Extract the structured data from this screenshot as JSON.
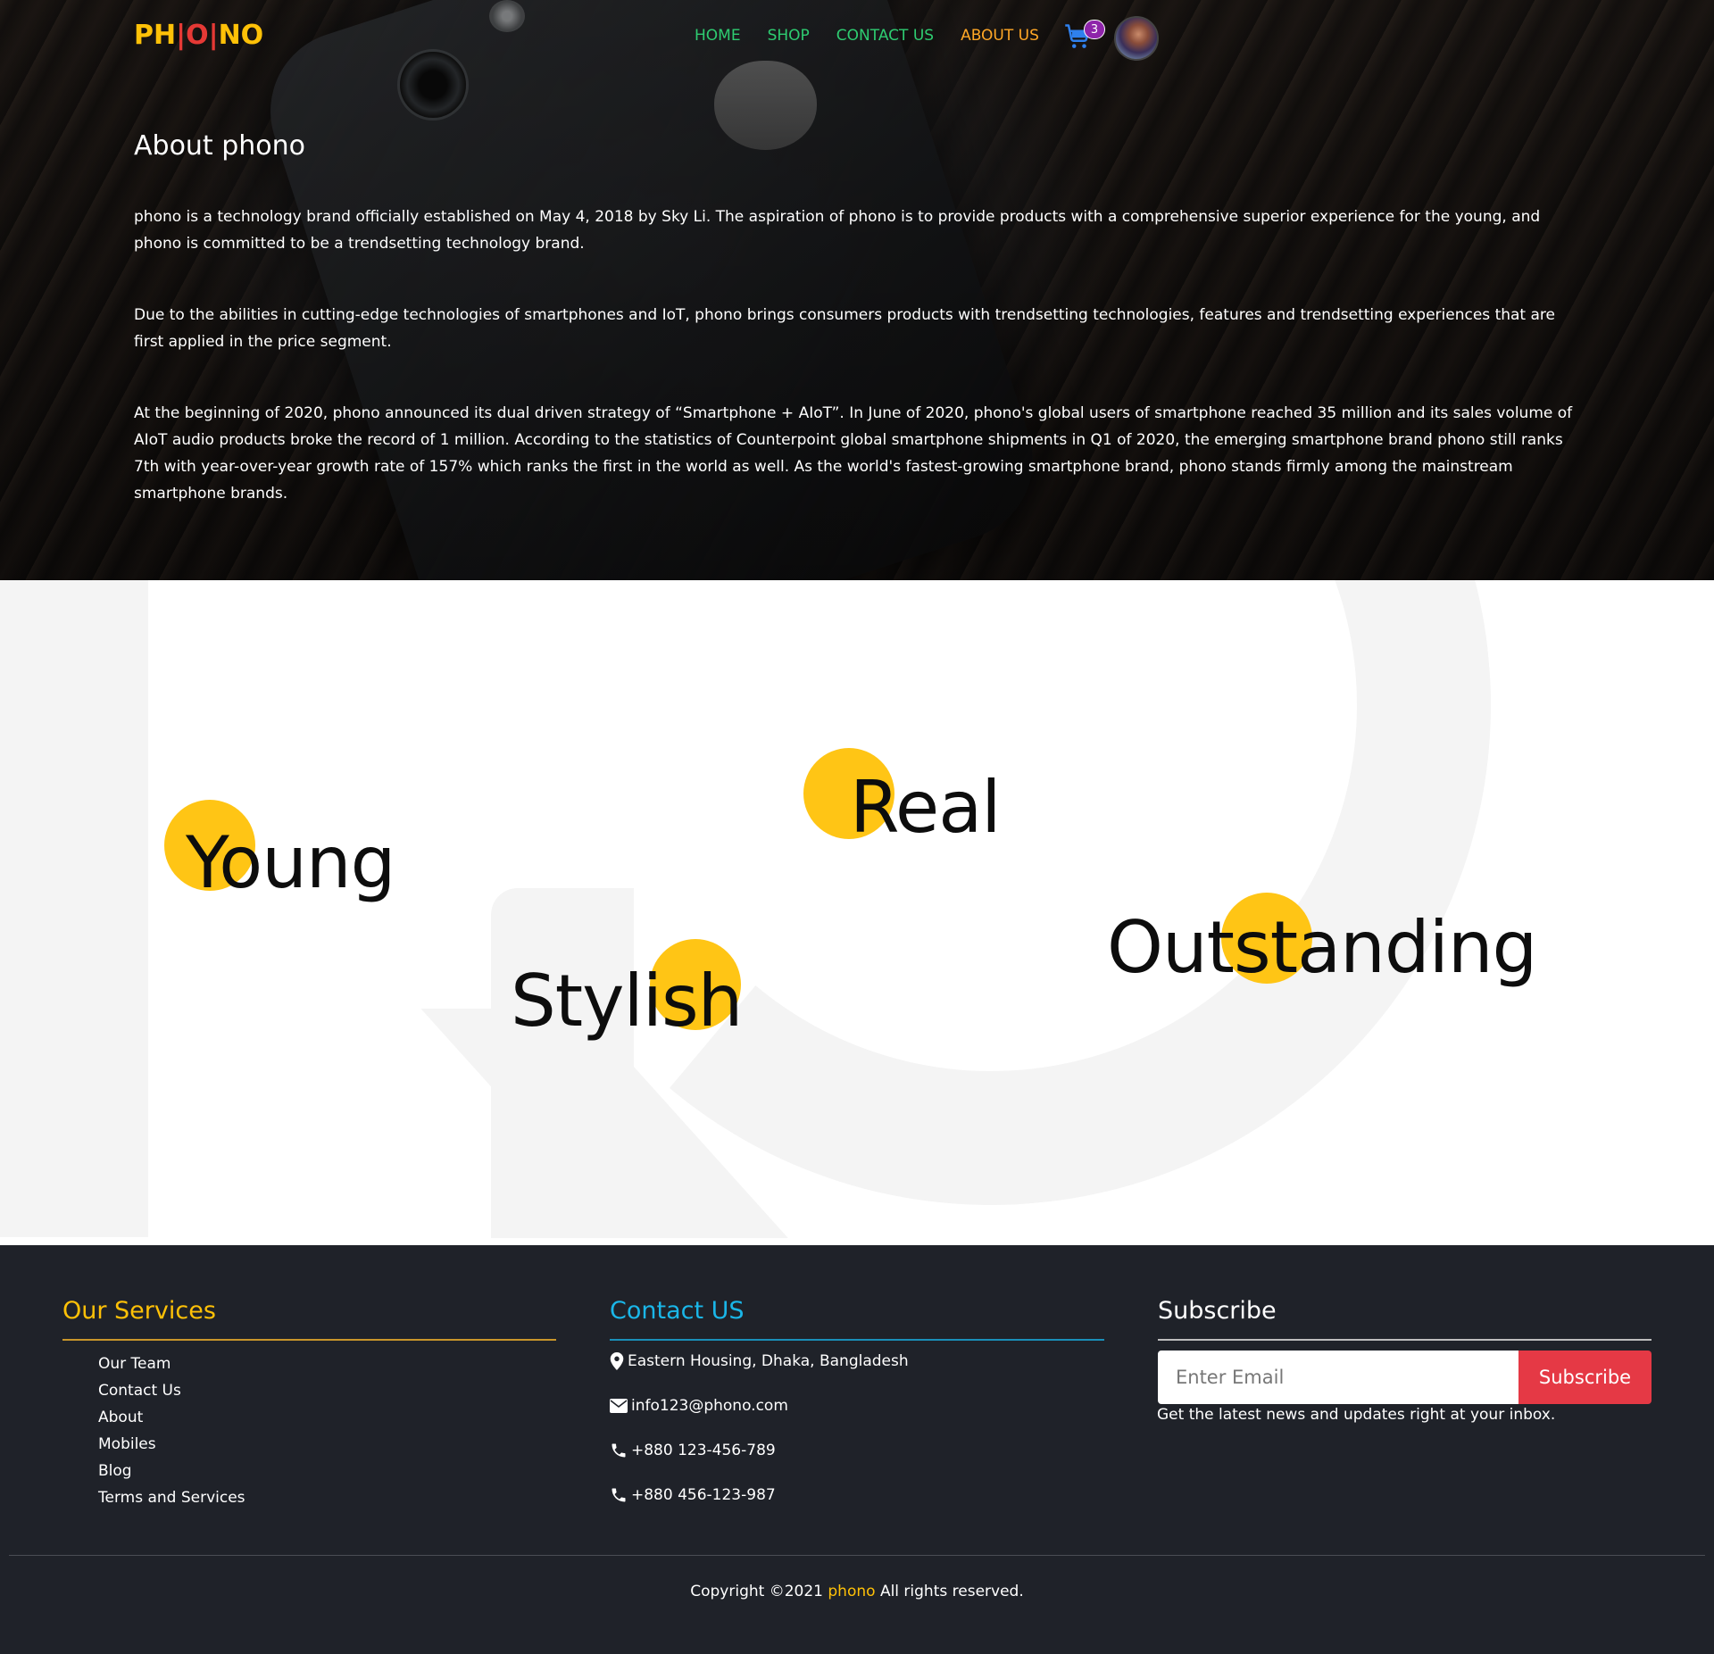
{
  "header": {
    "logo_parts": [
      "PH",
      "|",
      "O",
      "|",
      "NO"
    ],
    "nav": [
      {
        "label": "HOME",
        "color": "#2ecc71"
      },
      {
        "label": "SHOP",
        "color": "#2ecc71"
      },
      {
        "label": "CONTACT US",
        "color": "#2ecc71"
      },
      {
        "label": "ABOUT US",
        "color": "#ffa726"
      }
    ],
    "cart_count": "3",
    "cart_icon": "shopping-cart-icon",
    "avatar": "user-avatar"
  },
  "about": {
    "title": "About phono",
    "paragraphs": [
      "phono is a technology brand officially established on May 4, 2018 by Sky Li. The aspiration of phono is to provide products with a comprehensive superior experience for the young, and phono is committed to be a trendsetting technology brand.",
      "Due to the abilities in cutting-edge technologies of smartphones and IoT, phono brings consumers products with trendsetting technologies, features and trendsetting experiences that are first applied in the price segment.",
      "At the beginning of 2020, phono announced its dual driven strategy of “Smartphone + AIoT”. In June of 2020, phono's global users of smartphone reached 35 million and its sales volume of AIoT audio products broke the record of 1 million. According to the statistics of Counterpoint global smartphone shipments in Q1 of 2020, the emerging smartphone brand phono still ranks 7th with year-over-year growth rate of 157% which ranks the first in the world as well. As the world's fastest-growing smartphone brand, phono stands firmly among the mainstream smartphone brands."
    ]
  },
  "values": {
    "words": [
      "Young",
      "Real",
      "Stylish",
      "Outstanding"
    ],
    "accent": "#ffc515"
  },
  "footer": {
    "services": {
      "title": "Our Services",
      "color": "#ffc107",
      "items": [
        "Our Team",
        "Contact Us",
        "About",
        "Mobiles",
        "Blog",
        "Terms and Services"
      ]
    },
    "contact": {
      "title": "Contact US",
      "color": "#1ab6e8",
      "address": "Eastern Housing, Dhaka, Bangladesh",
      "email": "info123@phono.com",
      "phone1": "+880 123-456-789",
      "phone2": "+880 456-123-987"
    },
    "subscribe": {
      "title": "Subscribe",
      "placeholder": "Enter Email",
      "button": "Subscribe",
      "note": "Get the latest news and updates right at your inbox."
    },
    "copyright": {
      "before": "Copyright ©2021 ",
      "brand": "phono",
      "after": " All rights reserved."
    }
  }
}
